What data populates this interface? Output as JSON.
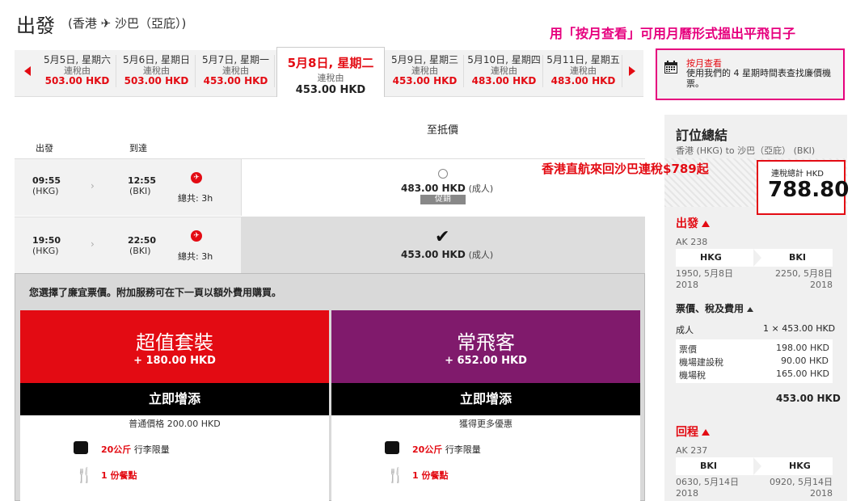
{
  "header": {
    "title": "出發",
    "route": "(香港 ✈ 沙巴（亞庇）)"
  },
  "annotations": {
    "top": "用「按月查看」可用月曆形式搵出平飛日子",
    "mid": "香港直航來回沙巴連稅$789起"
  },
  "date_strip": {
    "tax_label": "連稅由",
    "days": [
      {
        "date": "5月5日, 星期六",
        "price": "503.00 HKD"
      },
      {
        "date": "5月6日, 星期日",
        "price": "503.00 HKD"
      },
      {
        "date": "5月7日, 星期一",
        "price": "453.00 HKD"
      },
      {
        "date": "5月8日, 星期二",
        "price": "453.00 HKD",
        "selected": true
      },
      {
        "date": "5月9日, 星期三",
        "price": "453.00 HKD"
      },
      {
        "date": "5月10日, 星期四",
        "price": "483.00 HKD"
      },
      {
        "date": "5月11日, 星期五",
        "price": "483.00 HKD"
      }
    ]
  },
  "calendar": {
    "title": "按月查看",
    "desc": "使用我們的 4 星期時間表查找廉價機票。"
  },
  "table": {
    "cheapest_header": "至抵價",
    "dep_header": "出發",
    "arr_header": "到達",
    "rows": [
      {
        "dep_time": "09:55",
        "dep_code": "(HKG)",
        "arr_time": "12:55",
        "arr_code": "(BKI)",
        "duration": "總共: 3h",
        "price": "483.00 HKD",
        "pax": "(成人)",
        "promo": "促銷"
      },
      {
        "dep_time": "19:50",
        "dep_code": "(HKG)",
        "arr_time": "22:50",
        "arr_code": "(BKI)",
        "duration": "總共: 3h",
        "price": "453.00 HKD",
        "pax": "(成人)"
      }
    ]
  },
  "panel": {
    "note": "您選擇了廉宜票價。附加服務可在下一頁以額外費用購買。",
    "packages": [
      {
        "name": "超值套裝",
        "price": "+ 180.00 HKD",
        "button": "立即增添",
        "sub": "普通價格 200.00 HKD",
        "bag_amount": "20公斤",
        "bag_label": "行李限量",
        "meal": "1 份餐點"
      },
      {
        "name": "常飛客",
        "price": "+ 652.00 HKD",
        "button": "立即增添",
        "sub": "獲得更多優惠",
        "bag_amount": "20公斤",
        "bag_label": "行李限量",
        "meal": "1 份餐點"
      }
    ]
  },
  "summary": {
    "title": "訂位總結",
    "route": "香港 (HKG) to 沙巴（亞庇） (BKI)",
    "total_label": "連稅總計 HKD",
    "total_value": "788.80",
    "outbound": {
      "label": "出發",
      "flight": "AK 238",
      "from": "HKG",
      "to": "BKI",
      "dep_time": "1950, 5月8日",
      "dep_year": "2018",
      "arr_time": "2250, 5月8日",
      "arr_year": "2018"
    },
    "fare_title": "票價、稅及費用",
    "adult_label": "成人",
    "adult_value": "1 × 453.00 HKD",
    "breakdown": [
      {
        "label": "票價",
        "value": "198.00 HKD"
      },
      {
        "label": "機場建設稅",
        "value": "90.00 HKD"
      },
      {
        "label": "機場稅",
        "value": "165.00 HKD"
      }
    ],
    "fare_sum": "453.00 HKD",
    "return": {
      "label": "回程",
      "flight": "AK 237",
      "from": "BKI",
      "to": "HKG",
      "dep_time": "0630, 5月14日",
      "dep_year": "2018",
      "arr_time": "0920, 5月14日",
      "arr_year": "2018"
    }
  },
  "colors": {
    "brand_red": "#e30b13",
    "annotation_pink": "#e6007e",
    "frequent_flyer_purple": "#801a6c"
  }
}
